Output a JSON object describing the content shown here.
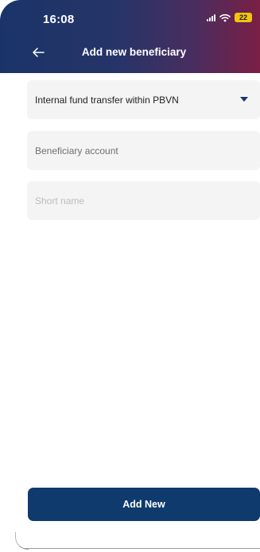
{
  "status_bar": {
    "time": "16:08",
    "battery": "22"
  },
  "header": {
    "title": "Add new beneficiary",
    "back_icon": "arrow-left-icon"
  },
  "form": {
    "transfer_type": {
      "selected": "Internal fund transfer within PBVN",
      "icon": "caret-down-icon"
    },
    "beneficiary_account": {
      "placeholder": "Beneficiary account",
      "value": ""
    },
    "short_name": {
      "placeholder": "Short name",
      "value": ""
    }
  },
  "actions": {
    "add_new_label": "Add New"
  },
  "colors": {
    "header_gradient_start": "#1a3469",
    "header_gradient_end": "#7a1f45",
    "primary_button": "#0e3a6e",
    "field_background": "#f4f4f4",
    "battery": "#f2c40c"
  }
}
